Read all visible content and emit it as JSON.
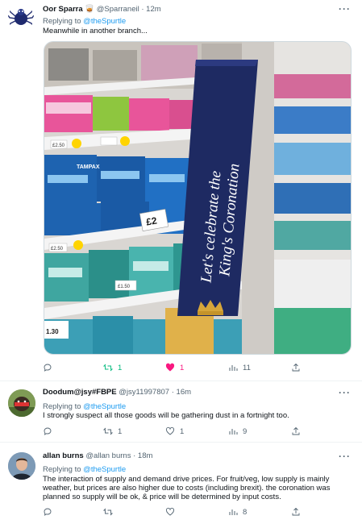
{
  "tweets": [
    {
      "name": "Oor Sparra",
      "badge_emoji": "🥃",
      "handle": "@Sparraneil",
      "time": "12m",
      "replying_label": "Replying to",
      "replying_to": "@theSpurtle",
      "text": "Meanwhile in another branch...",
      "actions": {
        "reply": "",
        "retweet": "1",
        "like": "1",
        "views": "11"
      },
      "colors": {
        "retweet": "#00ba7c",
        "like": "#f91880"
      }
    },
    {
      "name": "Doodum@jsy#FBPE",
      "handle": "@jsy11997807",
      "time": "16m",
      "replying_label": "Replying to",
      "replying_to": "@theSpurtle",
      "text": "I strongly suspect all those goods will be gathering dust in a fortnight too.",
      "actions": {
        "reply": "",
        "retweet": "1",
        "like": "1",
        "views": "9"
      }
    },
    {
      "name": "allan burns",
      "handle": "@allan burns",
      "time": "18m",
      "replying_label": "Replying to",
      "replying_to": "@theSpurtle",
      "text": "The interaction of supply and demand drive prices. For fruit/veg, low supply is mainly weather, but prices are also higher due to costs (including brexit). the coronation was planned so supply will be ok, & price will be determined by input costs.",
      "actions": {
        "reply": "",
        "retweet": "",
        "like": "",
        "views": "8"
      }
    }
  ],
  "media": {
    "banner_text_line1": "Let's celebrate the",
    "banner_text_line2": "King's Coronation",
    "shelf_price_label": "£2",
    "shelf_brand": "TAMPAX",
    "price_tag_1": "£2.50",
    "price_tag_2": "£2.50",
    "price_tag_3": "£1.50",
    "price_tag_4": "1.30"
  },
  "more_label": "···"
}
